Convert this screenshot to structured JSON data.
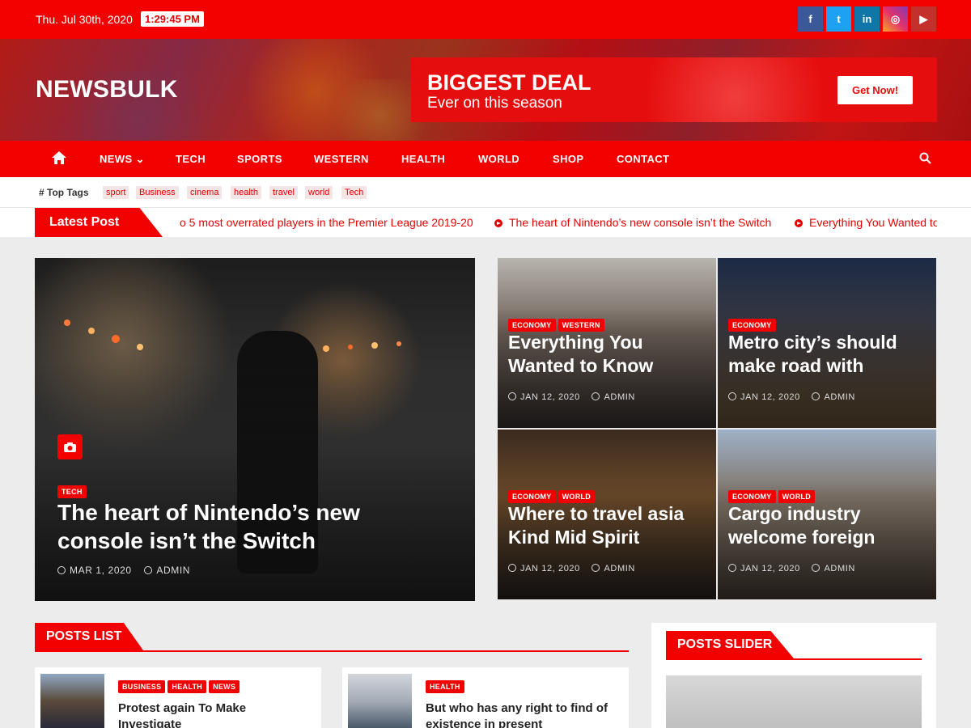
{
  "topbar": {
    "date": "Thu. Jul 30th, 2020",
    "time": "1:29:45 PM",
    "social": [
      {
        "name": "facebook-icon",
        "glyph": "f"
      },
      {
        "name": "twitter-icon",
        "glyph": "t"
      },
      {
        "name": "linkedin-icon",
        "glyph": "in"
      },
      {
        "name": "instagram-icon",
        "glyph": "◎"
      },
      {
        "name": "youtube-icon",
        "glyph": "▶"
      }
    ]
  },
  "header": {
    "logo": "NEWSBULK",
    "ad": {
      "title": "BIGGEST DEAL",
      "subtitle": "Ever on this season",
      "button": "Get Now!"
    }
  },
  "nav": {
    "items": [
      "NEWS",
      "TECH",
      "SPORTS",
      "WESTERN",
      "HEALTH",
      "WORLD",
      "SHOP",
      "CONTACT"
    ],
    "dropdown_caret": "⌄"
  },
  "tags": {
    "label": "# Top Tags",
    "items": [
      "sport",
      "Business",
      "cinema",
      "health",
      "travel",
      "world",
      "Tech"
    ]
  },
  "ticker": {
    "label": "Latest Post",
    "items": [
      "o 5 most overrated players in the Premier League 2019-20",
      "The heart of Nintendo’s new console isn’t the Switch",
      "Everything You Wanted to Know"
    ]
  },
  "hero": {
    "main": {
      "categories": [
        "TECH"
      ],
      "title": "The heart of Nintendo’s new console isn’t the Switch",
      "date": "MAR 1, 2020",
      "author": "ADMIN"
    },
    "side": [
      {
        "categories": [
          "ECONOMY",
          "WESTERN"
        ],
        "title": "Everything You Wanted to Know",
        "date": "JAN 12, 2020",
        "author": "ADMIN"
      },
      {
        "categories": [
          "ECONOMY"
        ],
        "title": "Metro city’s should make road with",
        "date": "JAN 12, 2020",
        "author": "ADMIN"
      },
      {
        "categories": [
          "ECONOMY",
          "WORLD"
        ],
        "title": "Where to travel asia Kind Mid Spirit",
        "date": "JAN 12, 2020",
        "author": "ADMIN"
      },
      {
        "categories": [
          "ECONOMY",
          "WORLD"
        ],
        "title": "Cargo industry welcome foreign",
        "date": "JAN 12, 2020",
        "author": "ADMIN"
      }
    ]
  },
  "posts_list": {
    "heading": "POSTS LIST",
    "posts": [
      {
        "categories": [
          "BUSINESS",
          "HEALTH",
          "NEWS"
        ],
        "title": "Protest again To Make Investigate"
      },
      {
        "categories": [
          "HEALTH"
        ],
        "title": "But who has any right to find of existence in present"
      }
    ]
  },
  "posts_slider": {
    "heading": "POSTS SLIDER"
  },
  "colors": {
    "brand_red": "#f20000",
    "white": "#ffffff"
  }
}
